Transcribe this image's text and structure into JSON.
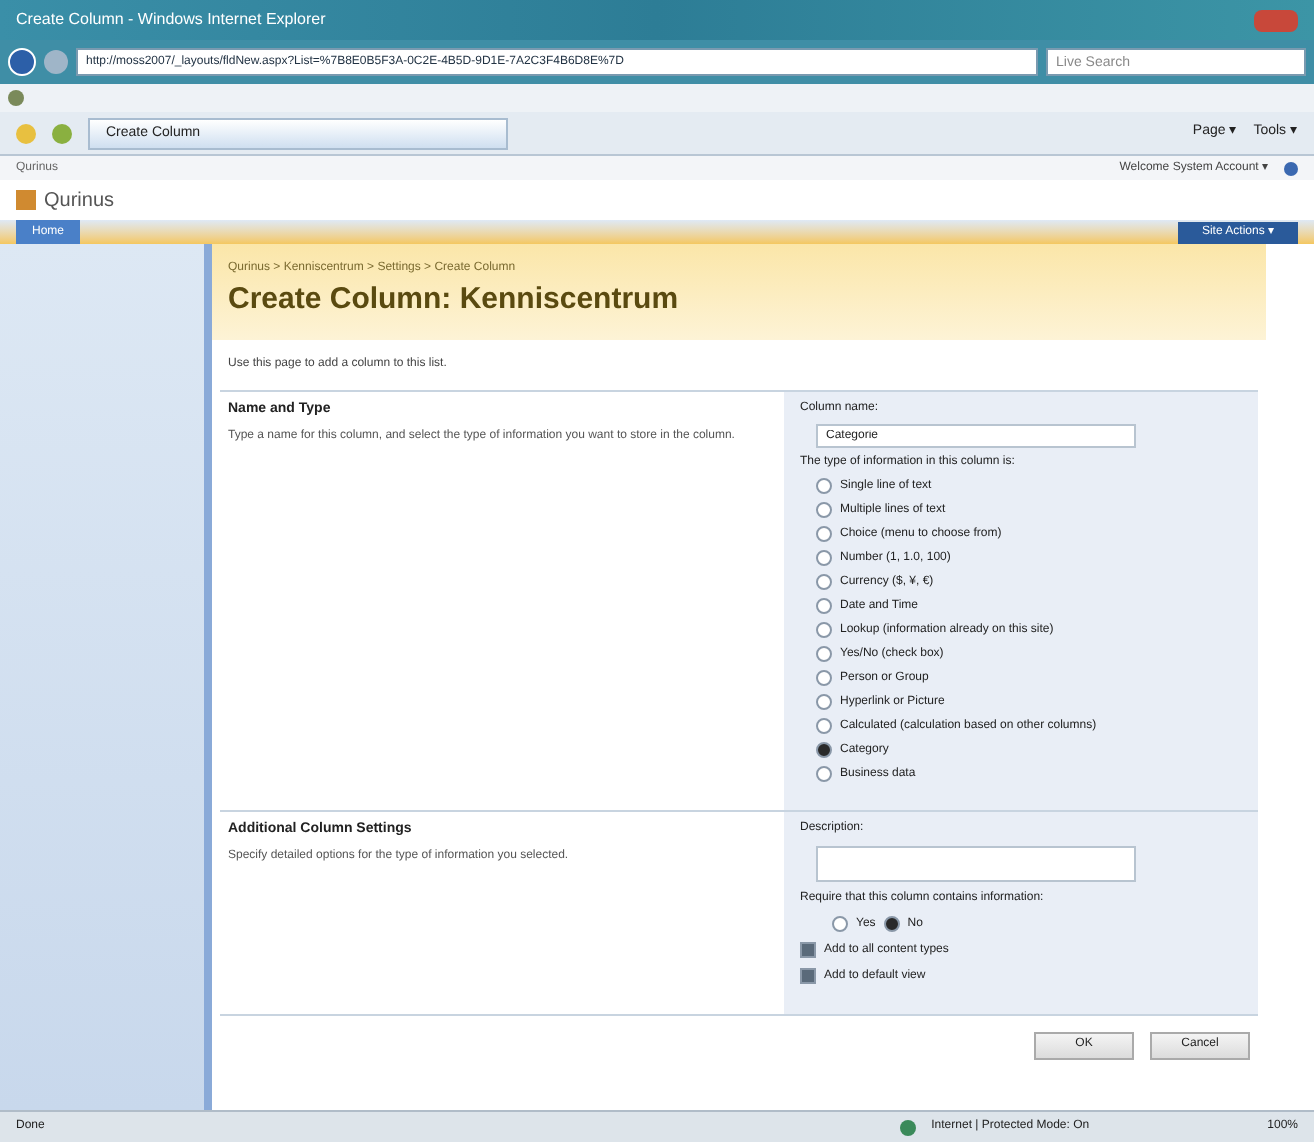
{
  "window": {
    "title": "Create Column - Windows Internet Explorer"
  },
  "address_bar": {
    "url": "http://moss2007/_layouts/fldNew.aspx?List=%7B8E0B5F3A-0C2E-4B5D-9D1E-7A2C3F4B6D8E%7D",
    "search_placeholder": "Live Search"
  },
  "browser_tab": {
    "label": "Create Column"
  },
  "command_bar": [
    "Page ▾",
    "Tools ▾"
  ],
  "site": {
    "top_label": "Qurinus",
    "welcome": "Welcome System Account ▾",
    "name": "Qurinus",
    "tabs": [
      {
        "label": "Home",
        "selected": true
      }
    ],
    "site_actions": "Site Actions ▾"
  },
  "breadcrumb": "Qurinus > Kenniscentrum > Settings > Create Column",
  "page_title": "Create Column: Kenniscentrum",
  "intro": "Use this page to add a column to this list.",
  "sections": [
    {
      "title": "Name and Type",
      "description": "Type a name for this column, and select the type of information you want to store in the column."
    },
    {
      "title": "Additional Column Settings",
      "description": "Specify detailed options for the type of information you selected."
    }
  ],
  "column_name": {
    "label": "Column name:",
    "value": "Categorie"
  },
  "type_label": "The type of information in this column is:",
  "types": [
    {
      "label": "Single line of text",
      "selected": false
    },
    {
      "label": "Multiple lines of text",
      "selected": false
    },
    {
      "label": "Choice (menu to choose from)",
      "selected": false
    },
    {
      "label": "Number (1, 1.0, 100)",
      "selected": false
    },
    {
      "label": "Currency ($, ¥, €)",
      "selected": false
    },
    {
      "label": "Date and Time",
      "selected": false
    },
    {
      "label": "Lookup (information already on this site)",
      "selected": false
    },
    {
      "label": "Yes/No (check box)",
      "selected": false
    },
    {
      "label": "Person or Group",
      "selected": false
    },
    {
      "label": "Hyperlink or Picture",
      "selected": false
    },
    {
      "label": "Calculated (calculation based on other columns)",
      "selected": false
    },
    {
      "label": "Category",
      "selected": true
    },
    {
      "label": "Business data",
      "selected": false
    }
  ],
  "description_label": "Description:",
  "require_label": "Require that this column contains information:",
  "require_options": [
    {
      "label": "Yes",
      "selected": false
    },
    {
      "label": "No",
      "selected": true
    }
  ],
  "checkboxes": [
    {
      "label": "Add to all content types",
      "checked": true
    },
    {
      "label": "Add to default view",
      "checked": true
    }
  ],
  "buttons": [
    "OK",
    "Cancel"
  ],
  "status_bar": {
    "status": "Done",
    "zone": "Internet | Protected Mode: On",
    "zoom": "100%"
  }
}
